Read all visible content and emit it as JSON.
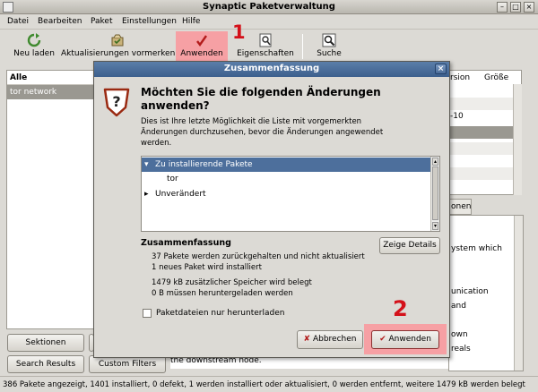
{
  "window": {
    "title": "Synaptic Paketverwaltung"
  },
  "menu": [
    "Datei",
    "Bearbeiten",
    "Paket",
    "Einstellungen",
    "Hilfe"
  ],
  "toolbar": {
    "reload": "Neu laden",
    "mark_upgrades": "Aktualisierungen vormerken",
    "apply": "Anwenden",
    "properties": "Eigenschaften",
    "search": "Suche"
  },
  "callouts": {
    "one": "1",
    "two": "2"
  },
  "filters": {
    "header": "Alle",
    "selected": "tor network"
  },
  "left_buttons": {
    "sections": "Sektionen",
    "search_results": "Search Results",
    "custom_filters": "Custom Filters"
  },
  "package_list": {
    "col_version": "rsion",
    "col_size": "Größe",
    "version_fragment": "-10"
  },
  "tab_fragment": "onen",
  "description_fragments": [
    "ystem which",
    "unication",
    "and",
    "own",
    "reals"
  ],
  "description_bottom": "the downstream node.",
  "status": "386 Pakete angezeigt, 1401 installiert, 0 defekt, 1 werden installiert oder aktualisiert, 0 werden entfernt, weitere 1479 kB werden belegt",
  "dialog": {
    "title": "Zusammenfassung",
    "heading": "Möchten Sie die folgenden Änderungen anwenden?",
    "info": "Dies ist Ihre letzte Möglichkeit die Liste mit vorgemerkten Änderungen durchzusehen, bevor die Änderungen angewendet werden.",
    "tree": [
      {
        "label": "Zu installierende Pakete",
        "expanded": true,
        "selected": true
      },
      {
        "label": "tor",
        "child": true
      },
      {
        "label": "Unverändert",
        "expanded": false
      }
    ],
    "summary_header": "Zusammenfassung",
    "details_button": "Zeige Details",
    "summary_lines": [
      "37 Pakete werden zurückgehalten und nicht aktualisiert",
      "1 neues Paket wird installiert",
      "1479 kB zusätzlicher Speicher wird belegt",
      "0  B müssen heruntergeladen werden"
    ],
    "download_only_label": "Paketdateien nur herunterladen",
    "cancel_button": "Abbrechen",
    "apply_button": "Anwenden"
  },
  "colors": {
    "highlight": "#f6a0a4",
    "callout": "#d4111a",
    "selection": "#4d6f9c",
    "dialog_title": "#4a6d99"
  }
}
